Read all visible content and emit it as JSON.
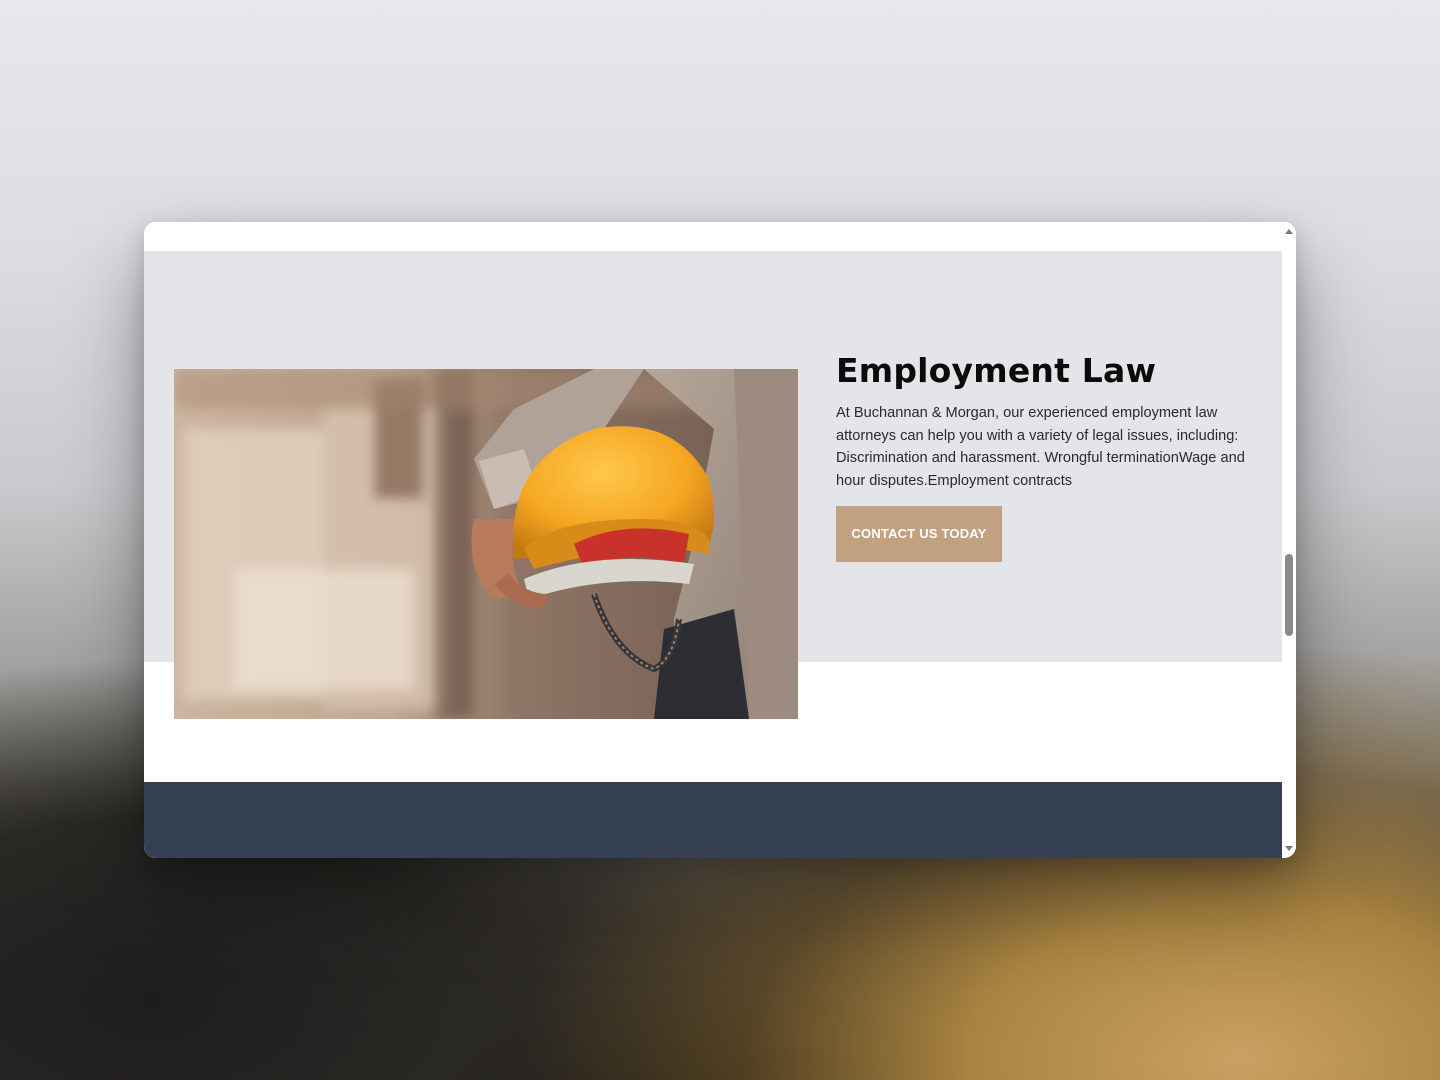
{
  "section": {
    "title": "Employment Law",
    "description": "At Buchannan & Morgan, our experienced employment law attorneys can help you with a variety of legal issues, including: Discrimination and harassment. Wrongful terminationWage and hour disputes.Employment contracts",
    "cta_label": "CONTACT US TODAY"
  },
  "image": {
    "subject": "worker-holding-hard-hat-photo"
  },
  "scrollbar": {
    "up_icon": "triangle-up",
    "down_icon": "triangle-down"
  },
  "colors": {
    "section_background": "#e4e5e9",
    "button_background": "#c2a181",
    "footer_background": "#354152",
    "hard_hat": "#f5a623"
  }
}
